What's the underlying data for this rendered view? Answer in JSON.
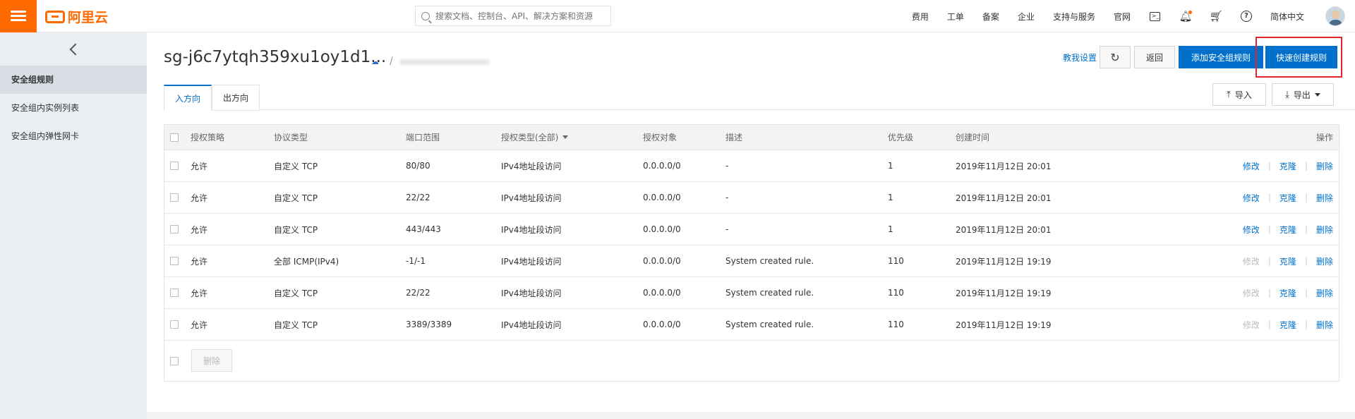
{
  "topbar": {
    "logo_text": "阿里云",
    "search_placeholder": "搜索文档、控制台、API、解决方案和资源",
    "nav": [
      "费用",
      "工单",
      "备案",
      "企业",
      "支持与服务",
      "官网"
    ],
    "language": "简体中文"
  },
  "sidebar": {
    "items": [
      {
        "label": "安全组规则",
        "active": true
      },
      {
        "label": "安全组内实例列表",
        "active": false
      },
      {
        "label": "安全组内弹性网卡",
        "active": false
      }
    ]
  },
  "header": {
    "title": "sg-j6c7ytqh359xu1oy1d1...",
    "tutorial_link": "教我设置",
    "back_label": "返回",
    "add_rule_label": "添加安全组规则",
    "quick_create_label": "快速创建规则"
  },
  "tabs": {
    "inbound": "入方向",
    "outbound": "出方向"
  },
  "toolbar": {
    "import_label": "导入",
    "export_label": "导出"
  },
  "table": {
    "columns": {
      "policy": "授权策略",
      "protocol": "协议类型",
      "port": "端口范围",
      "auth_type": "授权类型(全部)",
      "target": "授权对象",
      "desc": "描述",
      "priority": "优先级",
      "created": "创建时间",
      "actions": "操作"
    },
    "action_labels": {
      "edit": "修改",
      "clone": "克隆",
      "delete": "删除"
    },
    "rows": [
      {
        "policy": "允许",
        "protocol": "自定义 TCP",
        "port": "80/80",
        "auth_type": "IPv4地址段访问",
        "target": "0.0.0.0/0",
        "desc": "-",
        "priority": "1",
        "created": "2019年11月12日 20:01",
        "edit_disabled": false
      },
      {
        "policy": "允许",
        "protocol": "自定义 TCP",
        "port": "22/22",
        "auth_type": "IPv4地址段访问",
        "target": "0.0.0.0/0",
        "desc": "-",
        "priority": "1",
        "created": "2019年11月12日 20:01",
        "edit_disabled": false
      },
      {
        "policy": "允许",
        "protocol": "自定义 TCP",
        "port": "443/443",
        "auth_type": "IPv4地址段访问",
        "target": "0.0.0.0/0",
        "desc": "-",
        "priority": "1",
        "created": "2019年11月12日 20:01",
        "edit_disabled": false
      },
      {
        "policy": "允许",
        "protocol": "全部 ICMP(IPv4)",
        "port": "-1/-1",
        "auth_type": "IPv4地址段访问",
        "target": "0.0.0.0/0",
        "desc": "System created rule.",
        "priority": "110",
        "created": "2019年11月12日 19:19",
        "edit_disabled": true
      },
      {
        "policy": "允许",
        "protocol": "自定义 TCP",
        "port": "22/22",
        "auth_type": "IPv4地址段访问",
        "target": "0.0.0.0/0",
        "desc": "System created rule.",
        "priority": "110",
        "created": "2019年11月12日 19:19",
        "edit_disabled": true
      },
      {
        "policy": "允许",
        "protocol": "自定义 TCP",
        "port": "3389/3389",
        "auth_type": "IPv4地址段访问",
        "target": "0.0.0.0/0",
        "desc": "System created rule.",
        "priority": "110",
        "created": "2019年11月12日 19:19",
        "edit_disabled": true
      }
    ],
    "bulk_delete_label": "删除"
  },
  "colors": {
    "brand": "#ff6a00",
    "primary": "#0070cc",
    "highlight": "#e3242b"
  }
}
